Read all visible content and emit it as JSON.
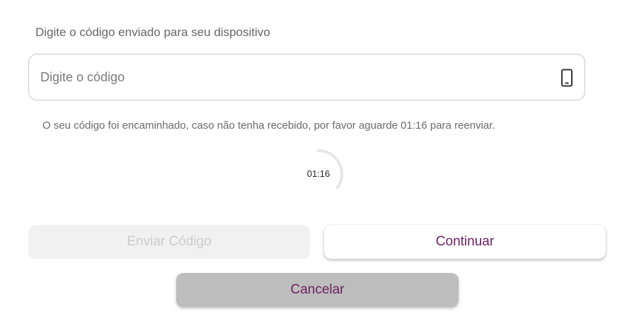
{
  "prompt_label": "Digite o código enviado para seu dispositivo",
  "code_input": {
    "placeholder": "Digite o código",
    "value": ""
  },
  "icons": {
    "device": "smartphone-icon"
  },
  "info_message": "O seu código foi encaminhado, caso não tenha recebido, por favor aguarde 01:16 para reenviar.",
  "timer": {
    "label": "01:16",
    "progress_fraction": 0.35,
    "track_color": "#e6e6e6",
    "progress_color": "#e6e6e6"
  },
  "buttons": {
    "send_code": "Enviar Código",
    "continue": "Continuar",
    "cancel": "Cancelar"
  },
  "colors": {
    "accent_text": "#6d1f5f",
    "disabled_bg": "#f1f1f1",
    "disabled_text": "#cccccc",
    "cancel_bg": "#bdbdbd"
  }
}
